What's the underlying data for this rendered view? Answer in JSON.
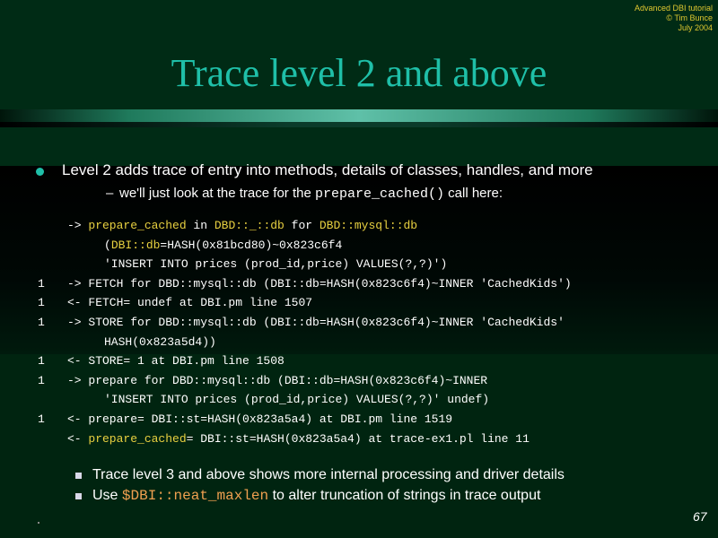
{
  "credit": {
    "line1": "Advanced DBI tutorial",
    "line2": "© Tim Bunce",
    "line3": "July 2004"
  },
  "title": "Trace level 2 and above",
  "bullet1": "Level 2 adds trace of entry into methods, details of classes, handles, and more",
  "sub_bullet": {
    "dash": "–",
    "before": "we'll just look at the trace for the ",
    "code": "prepare_cached()",
    "after": " call here:"
  },
  "trace": [
    {
      "num": "",
      "indent": false,
      "parts": [
        [
          "-> ",
          false
        ],
        [
          "prepare_cached",
          true
        ],
        [
          " in ",
          false
        ],
        [
          "DBD::_::db",
          true
        ],
        [
          " for ",
          false
        ],
        [
          "DBD::mysql::db",
          true
        ]
      ]
    },
    {
      "num": "",
      "indent": true,
      "parts": [
        [
          "(",
          false
        ],
        [
          "DBI::db",
          true
        ],
        [
          "=HASH(0x81bcd80)~0x823c6f4",
          false
        ]
      ]
    },
    {
      "num": "",
      "indent": true,
      "parts": [
        [
          "'INSERT INTO prices (prod_id,price) VALUES(?,?)')",
          false
        ]
      ]
    },
    {
      "num": "1",
      "indent": false,
      "parts": [
        [
          "-> FETCH for DBD::mysql::db (DBI::db=HASH(0x823c6f4)~INNER 'CachedKids')",
          false
        ]
      ]
    },
    {
      "num": "1",
      "indent": false,
      "parts": [
        [
          "<- FETCH= undef at DBI.pm line 1507",
          false
        ]
      ]
    },
    {
      "num": "1",
      "indent": false,
      "parts": [
        [
          "-> STORE for DBD::mysql::db (DBI::db=HASH(0x823c6f4)~INNER 'CachedKids'",
          false
        ]
      ]
    },
    {
      "num": "",
      "indent": true,
      "parts": [
        [
          "HASH(0x823a5d4))",
          false
        ]
      ]
    },
    {
      "num": "1",
      "indent": false,
      "parts": [
        [
          "<- STORE= 1 at DBI.pm line 1508",
          false
        ]
      ]
    },
    {
      "num": "1",
      "indent": false,
      "parts": [
        [
          "-> prepare for DBD::mysql::db (DBI::db=HASH(0x823c6f4)~INNER",
          false
        ]
      ]
    },
    {
      "num": "",
      "indent": true,
      "parts": [
        [
          "'INSERT INTO prices (prod_id,price) VALUES(?,?)' undef)",
          false
        ]
      ]
    },
    {
      "num": "1",
      "indent": false,
      "parts": [
        [
          "<- prepare= DBI::st=HASH(0x823a5a4) at DBI.pm line 1519",
          false
        ]
      ]
    },
    {
      "num": "",
      "indent": false,
      "parts": [
        [
          "<- ",
          false
        ],
        [
          "prepare_cached",
          true
        ],
        [
          "= DBI::st=HASH(0x823a5a4) at trace-ex1.pl line 11",
          false
        ]
      ]
    }
  ],
  "bullets_bottom": [
    {
      "before": "Trace level 3 and above shows more internal processing and driver details",
      "code": "",
      "after": ""
    },
    {
      "before": "Use ",
      "code": "$DBI::neat_maxlen",
      "after": " to alter truncation of strings in trace output"
    }
  ],
  "footer_mark": ".",
  "page_number": "67",
  "colors": {
    "title": "#1fbfa8",
    "highlight": "#e8d040",
    "code_orange": "#f0a050",
    "credit": "#e0c830"
  }
}
